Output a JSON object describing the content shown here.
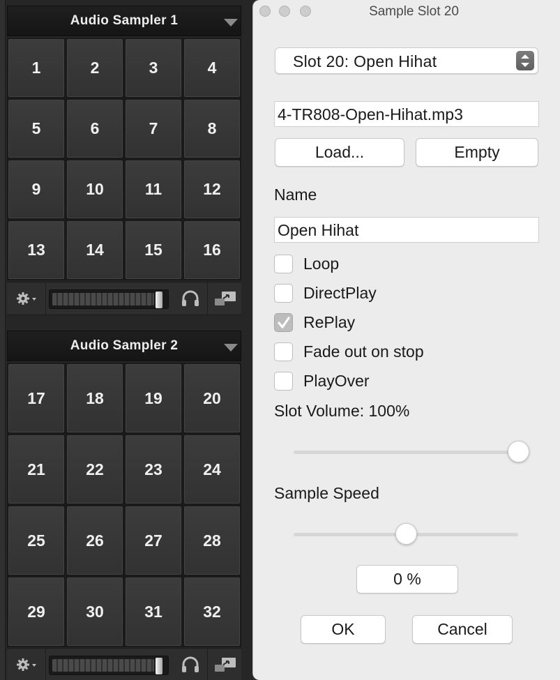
{
  "samplers": [
    {
      "title": "Audio Sampler 1",
      "pads": [
        "1",
        "2",
        "3",
        "4",
        "5",
        "6",
        "7",
        "8",
        "9",
        "10",
        "11",
        "12",
        "13",
        "14",
        "15",
        "16"
      ]
    },
    {
      "title": "Audio Sampler 2",
      "pads": [
        "17",
        "18",
        "19",
        "20",
        "21",
        "22",
        "23",
        "24",
        "25",
        "26",
        "27",
        "28",
        "29",
        "30",
        "31",
        "32"
      ]
    }
  ],
  "dialog": {
    "window_title": "Sample Slot 20",
    "slot_selector": "Slot 20: Open Hihat",
    "file_name": "4-TR808-Open-Hihat.mp3",
    "load_label": "Load...",
    "empty_label": "Empty",
    "name_label": "Name",
    "name_value": "Open Hihat",
    "options": [
      {
        "label": "Loop",
        "checked": false
      },
      {
        "label": "DirectPlay",
        "checked": false
      },
      {
        "label": "RePlay",
        "checked": true
      },
      {
        "label": "Fade out on stop",
        "checked": false
      },
      {
        "label": "PlayOver",
        "checked": false
      }
    ],
    "slot_volume_label": "Slot Volume: 100%",
    "slot_volume_level": 1.0,
    "sample_speed_label": "Sample Speed",
    "sample_speed_level": 0.5,
    "speed_value": "0 %",
    "ok_label": "OK",
    "cancel_label": "Cancel"
  },
  "icons": {
    "settings": "gear-icon",
    "dropdown": "chevron-down-icon",
    "headphones": "headphones-icon",
    "output": "output-route-icon",
    "checkmark": "checkmark-icon"
  }
}
